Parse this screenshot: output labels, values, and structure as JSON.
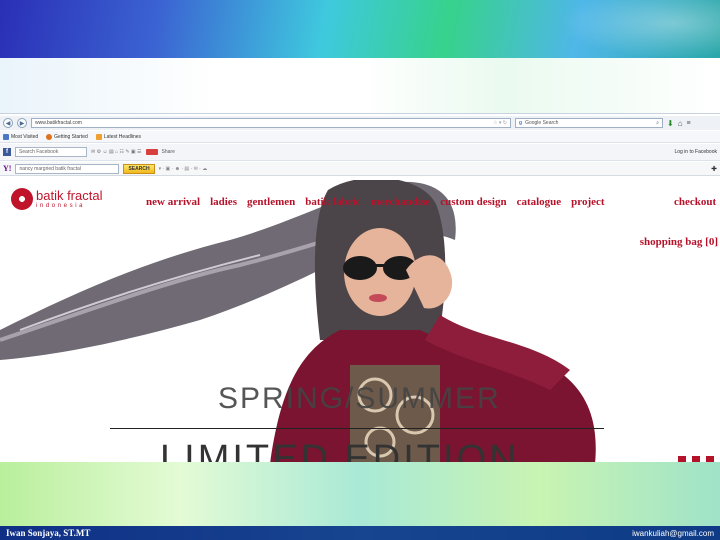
{
  "browser": {
    "url": "www.batikfractal.com",
    "search_engine": "Google",
    "search_placeholder": "Google Search",
    "bookmarks": [
      "Most Visited",
      "Getting Started",
      "Latest Headlines"
    ],
    "facebook_search_placeholder": "Search Facebook",
    "facebook_toolbar_items": [
      "Share",
      "Log in to Facebook"
    ],
    "yahoo_query": "nancy margried batik fractal",
    "yahoo_search_label": "SEARCH"
  },
  "site": {
    "logo_main": "batik fractal",
    "logo_sub": "indonesia",
    "menu": [
      "new arrival",
      "ladies",
      "gentlemen",
      "batik fabric",
      "merchandise",
      "custom design",
      "catalogue",
      "project"
    ],
    "checkout_label": "checkout",
    "shopping_bag_label": "shopping bag [0]",
    "hero_line_1": "SPRING/SUMMER",
    "hero_line_2": "LIMITED EDITION"
  },
  "footer": {
    "author": "Iwan Sonjaya, ST.MT",
    "email": "iwankuliah@gmail.com"
  },
  "colors": {
    "brand_red": "#b5122a",
    "dress_maroon": "#7a1430",
    "scarf_grey": "#6f6a73"
  }
}
